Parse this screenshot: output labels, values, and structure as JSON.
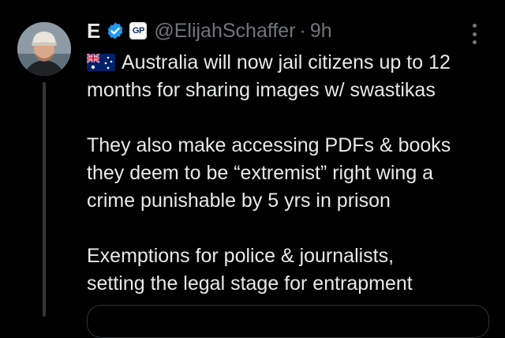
{
  "tweet": {
    "author_name": "E",
    "handle": "@ElijahSchaffer",
    "separator": "·",
    "time": "9h",
    "affiliation_badge": "GP",
    "icons": {
      "verified": "verified-check-icon",
      "flag": "australia-flag-icon",
      "more": "more-options-icon"
    },
    "text_lines": {
      "p1_l1": "Australia will now jail citizens up to 12",
      "p1_l2": "months for sharing images w/ swastikas",
      "p2_l1": "They also make accessing PDFs & books",
      "p2_l2": "they deem to be “extremist” right wing a",
      "p2_l3": "crime punishable by 5 yrs in prison",
      "p3_l1": "Exemptions for police & journalists,",
      "p3_l2": "setting the legal stage for entrapment"
    },
    "colors": {
      "background": "#000000",
      "text": "#e7e9ea",
      "secondary": "#71767b",
      "verified": "#1d9bf0"
    }
  }
}
